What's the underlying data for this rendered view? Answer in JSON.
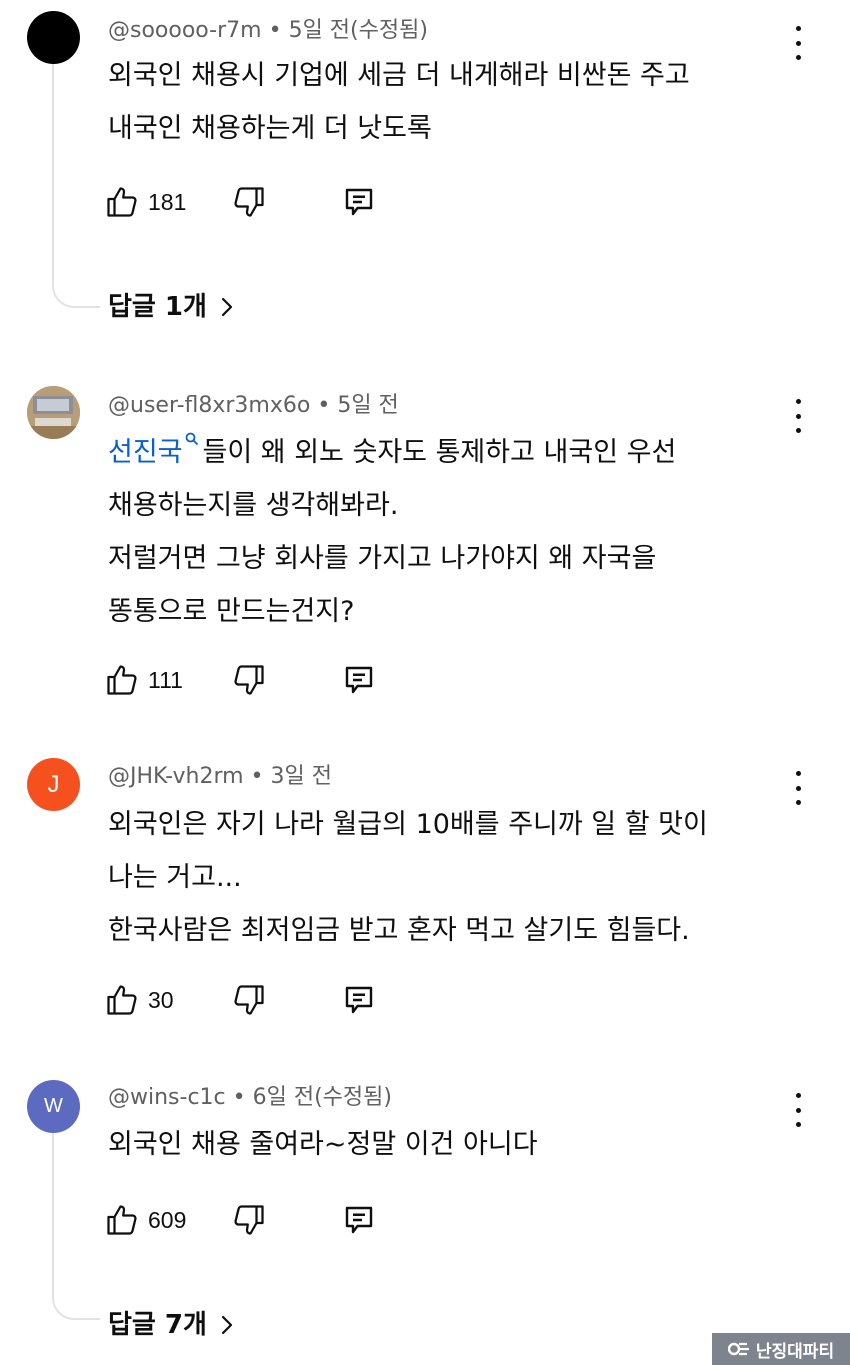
{
  "comments": [
    {
      "avatar_color": "#000000",
      "avatar_letter": "",
      "author": "@sooooo-r7m",
      "time": "5일 전(수정됨)",
      "lines": [
        "외국인 채용시 기업에 세금 더 내게해라 비싼돈 주고",
        "내국인 채용하는게 더 낫도록"
      ],
      "likes": "181",
      "replies": "답글 1개"
    },
    {
      "avatar_color": "#a9957a",
      "avatar_letter": "",
      "author": "@user-fl8xr3mx6o",
      "time": "5일 전",
      "highlight": "선진국",
      "lines": [
        "들이 왜 외노 숫자도 통제하고 내국인 우선",
        "채용하는지를 생각해봐라.",
        "저럴거면 그냥 회사를 가지고 나가야지 왜 자국을",
        "똥통으로 만드는건지?"
      ],
      "likes": "111"
    },
    {
      "avatar_color": "#f4511e",
      "avatar_letter": "J",
      "author": "@JHK-vh2rm",
      "time": "3일 전",
      "lines": [
        "외국인은 자기 나라 월급의 10배를 주니까 일 할 맛이",
        "나는 거고...",
        "한국사람은 최저임금 받고 혼자 먹고 살기도 힘들다."
      ],
      "likes": "30"
    },
    {
      "avatar_color": "#5c6bc0",
      "avatar_letter": "W",
      "author": "@wins-c1c",
      "time": "6일 전(수정됨)",
      "lines": [
        "외국인 채용 줄여라~정말 이건 아니다"
      ],
      "likes": "609",
      "replies": "답글 7개"
    }
  ],
  "separator": "•",
  "watermark": "난징대파티",
  "icons": {
    "like": "thumb-up-icon",
    "dislike": "thumb-down-icon",
    "reply": "comment-reply-icon",
    "more": "kebab-menu-icon",
    "replies_arrow": "chevron-right-icon"
  }
}
